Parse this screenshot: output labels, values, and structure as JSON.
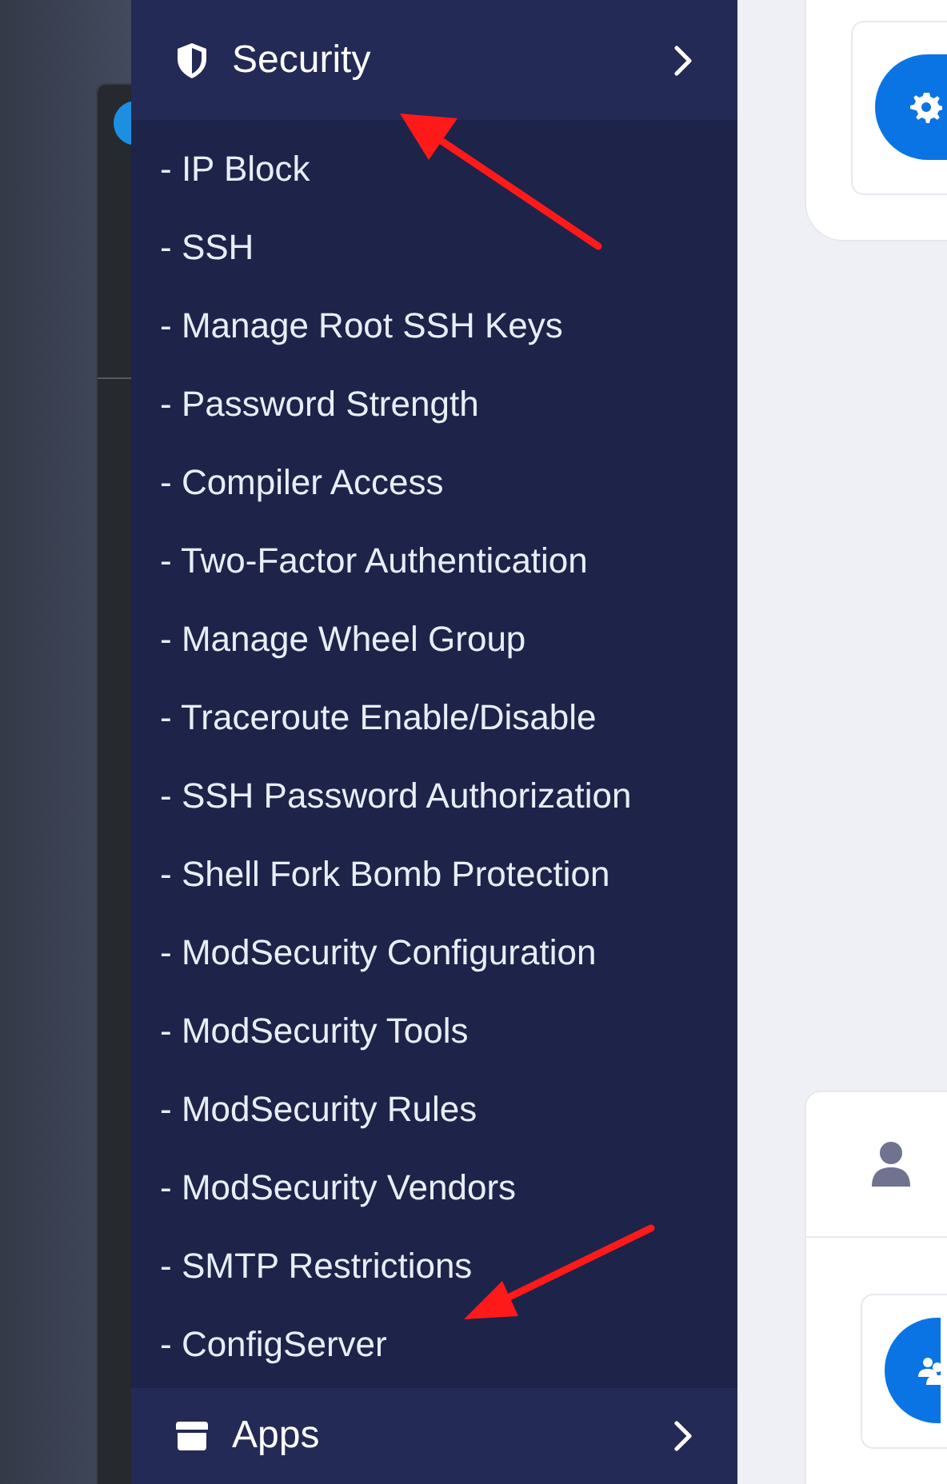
{
  "sidebar": {
    "sections": [
      {
        "label": "Security",
        "kind": "security",
        "expanded": true,
        "children": [
          {
            "label": "- IP Block"
          },
          {
            "label": "- SSH"
          },
          {
            "label": "- Manage Root SSH Keys"
          },
          {
            "label": "- Password Strength"
          },
          {
            "label": "- Compiler Access"
          },
          {
            "label": "- Two-Factor Authentication"
          },
          {
            "label": "- Manage Wheel Group"
          },
          {
            "label": "- Traceroute Enable/Disable"
          },
          {
            "label": "- SSH Password Authorization"
          },
          {
            "label": "- Shell Fork Bomb Protection"
          },
          {
            "label": "- ModSecurity Configuration"
          },
          {
            "label": "- ModSecurity Tools"
          },
          {
            "label": "- ModSecurity Rules"
          },
          {
            "label": "- ModSecurity Vendors"
          },
          {
            "label": "- SMTP Restrictions"
          },
          {
            "label": "- ConfigServer"
          }
        ]
      },
      {
        "label": "Apps",
        "kind": "apps",
        "expanded": false
      }
    ]
  }
}
